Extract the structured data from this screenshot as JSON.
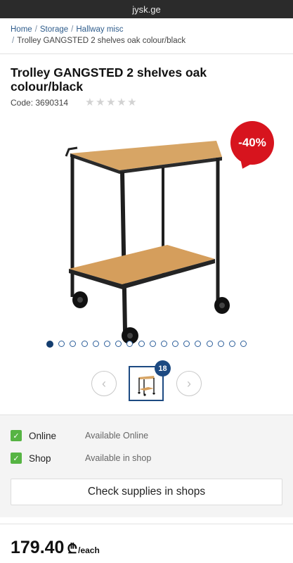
{
  "browser": {
    "url": "jysk.ge"
  },
  "breadcrumb": {
    "items": [
      "Home",
      "Storage",
      "Hallway misc"
    ],
    "current": "Trolley GANGSTED 2 shelves oak colour/black",
    "separator": "/"
  },
  "product": {
    "title": "Trolley GANGSTED 2 shelves oak colour/black",
    "code_label": "Code: 3690314",
    "rating_stars": 5,
    "rating_value": 0,
    "discount_badge": "-40%",
    "image_icon": "trolley-image",
    "gallery": {
      "count_badge": "18",
      "dots_total": 18,
      "active_index": 0
    }
  },
  "availability": [
    {
      "label": "Online",
      "status": "Available Online",
      "checked": true
    },
    {
      "label": "Shop",
      "status": "Available in shop",
      "checked": true
    }
  ],
  "actions": {
    "check_supplies_label": "Check supplies in shops"
  },
  "price": {
    "value": "179.40",
    "currency": "₾",
    "unit": "/each"
  },
  "colors": {
    "accent_blue": "#1d4a82",
    "discount_red": "#d7141e",
    "check_green": "#56b443"
  }
}
